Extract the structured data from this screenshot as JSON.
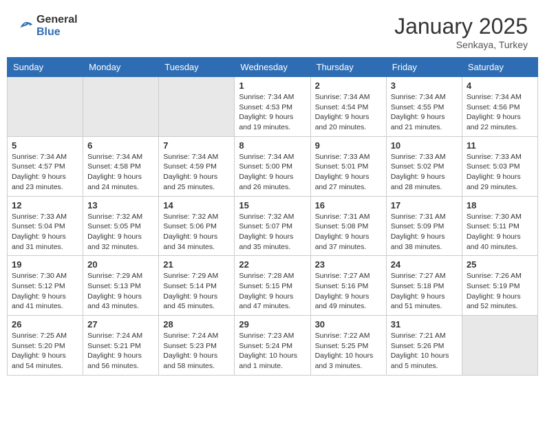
{
  "header": {
    "logo_general": "General",
    "logo_blue": "Blue",
    "month": "January 2025",
    "location": "Senkaya, Turkey"
  },
  "weekdays": [
    "Sunday",
    "Monday",
    "Tuesday",
    "Wednesday",
    "Thursday",
    "Friday",
    "Saturday"
  ],
  "weeks": [
    [
      {
        "day": "",
        "shaded": true,
        "info": ""
      },
      {
        "day": "",
        "shaded": true,
        "info": ""
      },
      {
        "day": "",
        "shaded": true,
        "info": ""
      },
      {
        "day": "1",
        "shaded": false,
        "info": "Sunrise: 7:34 AM\nSunset: 4:53 PM\nDaylight: 9 hours\nand 19 minutes."
      },
      {
        "day": "2",
        "shaded": false,
        "info": "Sunrise: 7:34 AM\nSunset: 4:54 PM\nDaylight: 9 hours\nand 20 minutes."
      },
      {
        "day": "3",
        "shaded": false,
        "info": "Sunrise: 7:34 AM\nSunset: 4:55 PM\nDaylight: 9 hours\nand 21 minutes."
      },
      {
        "day": "4",
        "shaded": false,
        "info": "Sunrise: 7:34 AM\nSunset: 4:56 PM\nDaylight: 9 hours\nand 22 minutes."
      }
    ],
    [
      {
        "day": "5",
        "shaded": false,
        "info": "Sunrise: 7:34 AM\nSunset: 4:57 PM\nDaylight: 9 hours\nand 23 minutes."
      },
      {
        "day": "6",
        "shaded": false,
        "info": "Sunrise: 7:34 AM\nSunset: 4:58 PM\nDaylight: 9 hours\nand 24 minutes."
      },
      {
        "day": "7",
        "shaded": false,
        "info": "Sunrise: 7:34 AM\nSunset: 4:59 PM\nDaylight: 9 hours\nand 25 minutes."
      },
      {
        "day": "8",
        "shaded": false,
        "info": "Sunrise: 7:34 AM\nSunset: 5:00 PM\nDaylight: 9 hours\nand 26 minutes."
      },
      {
        "day": "9",
        "shaded": false,
        "info": "Sunrise: 7:33 AM\nSunset: 5:01 PM\nDaylight: 9 hours\nand 27 minutes."
      },
      {
        "day": "10",
        "shaded": false,
        "info": "Sunrise: 7:33 AM\nSunset: 5:02 PM\nDaylight: 9 hours\nand 28 minutes."
      },
      {
        "day": "11",
        "shaded": false,
        "info": "Sunrise: 7:33 AM\nSunset: 5:03 PM\nDaylight: 9 hours\nand 29 minutes."
      }
    ],
    [
      {
        "day": "12",
        "shaded": false,
        "info": "Sunrise: 7:33 AM\nSunset: 5:04 PM\nDaylight: 9 hours\nand 31 minutes."
      },
      {
        "day": "13",
        "shaded": false,
        "info": "Sunrise: 7:32 AM\nSunset: 5:05 PM\nDaylight: 9 hours\nand 32 minutes."
      },
      {
        "day": "14",
        "shaded": false,
        "info": "Sunrise: 7:32 AM\nSunset: 5:06 PM\nDaylight: 9 hours\nand 34 minutes."
      },
      {
        "day": "15",
        "shaded": false,
        "info": "Sunrise: 7:32 AM\nSunset: 5:07 PM\nDaylight: 9 hours\nand 35 minutes."
      },
      {
        "day": "16",
        "shaded": false,
        "info": "Sunrise: 7:31 AM\nSunset: 5:08 PM\nDaylight: 9 hours\nand 37 minutes."
      },
      {
        "day": "17",
        "shaded": false,
        "info": "Sunrise: 7:31 AM\nSunset: 5:09 PM\nDaylight: 9 hours\nand 38 minutes."
      },
      {
        "day": "18",
        "shaded": false,
        "info": "Sunrise: 7:30 AM\nSunset: 5:11 PM\nDaylight: 9 hours\nand 40 minutes."
      }
    ],
    [
      {
        "day": "19",
        "shaded": false,
        "info": "Sunrise: 7:30 AM\nSunset: 5:12 PM\nDaylight: 9 hours\nand 41 minutes."
      },
      {
        "day": "20",
        "shaded": false,
        "info": "Sunrise: 7:29 AM\nSunset: 5:13 PM\nDaylight: 9 hours\nand 43 minutes."
      },
      {
        "day": "21",
        "shaded": false,
        "info": "Sunrise: 7:29 AM\nSunset: 5:14 PM\nDaylight: 9 hours\nand 45 minutes."
      },
      {
        "day": "22",
        "shaded": false,
        "info": "Sunrise: 7:28 AM\nSunset: 5:15 PM\nDaylight: 9 hours\nand 47 minutes."
      },
      {
        "day": "23",
        "shaded": false,
        "info": "Sunrise: 7:27 AM\nSunset: 5:16 PM\nDaylight: 9 hours\nand 49 minutes."
      },
      {
        "day": "24",
        "shaded": false,
        "info": "Sunrise: 7:27 AM\nSunset: 5:18 PM\nDaylight: 9 hours\nand 51 minutes."
      },
      {
        "day": "25",
        "shaded": false,
        "info": "Sunrise: 7:26 AM\nSunset: 5:19 PM\nDaylight: 9 hours\nand 52 minutes."
      }
    ],
    [
      {
        "day": "26",
        "shaded": false,
        "info": "Sunrise: 7:25 AM\nSunset: 5:20 PM\nDaylight: 9 hours\nand 54 minutes."
      },
      {
        "day": "27",
        "shaded": false,
        "info": "Sunrise: 7:24 AM\nSunset: 5:21 PM\nDaylight: 9 hours\nand 56 minutes."
      },
      {
        "day": "28",
        "shaded": false,
        "info": "Sunrise: 7:24 AM\nSunset: 5:23 PM\nDaylight: 9 hours\nand 58 minutes."
      },
      {
        "day": "29",
        "shaded": false,
        "info": "Sunrise: 7:23 AM\nSunset: 5:24 PM\nDaylight: 10 hours\nand 1 minute."
      },
      {
        "day": "30",
        "shaded": false,
        "info": "Sunrise: 7:22 AM\nSunset: 5:25 PM\nDaylight: 10 hours\nand 3 minutes."
      },
      {
        "day": "31",
        "shaded": false,
        "info": "Sunrise: 7:21 AM\nSunset: 5:26 PM\nDaylight: 10 hours\nand 5 minutes."
      },
      {
        "day": "",
        "shaded": true,
        "info": ""
      }
    ]
  ]
}
